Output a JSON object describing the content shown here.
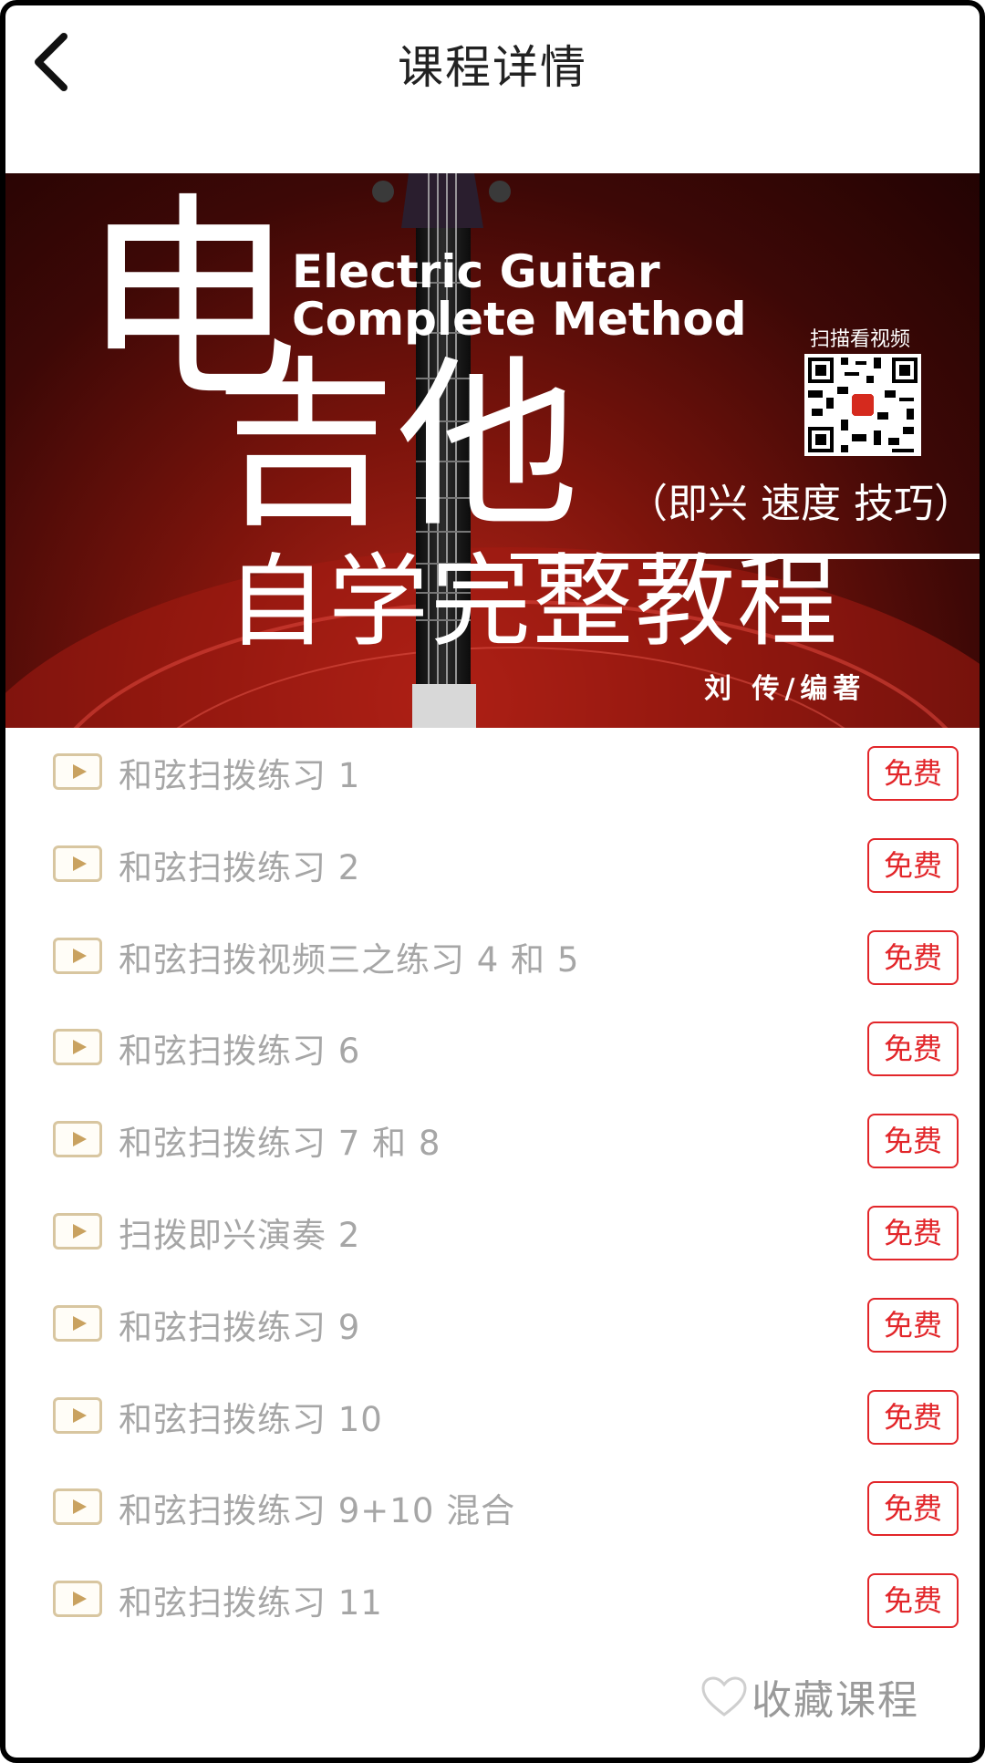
{
  "header": {
    "title": "课程详情",
    "back_icon": "chevron-left-icon"
  },
  "banner": {
    "title_en_line1": "Electric Guitar",
    "title_en_line2": "Complete Method",
    "title_cn_big1": "电",
    "title_cn_big2": "吉他",
    "subtitle": "（即兴 速度 技巧）",
    "main_title": "自学完整教程",
    "author": "刘 传/编著",
    "scan_label": "扫描看视频",
    "watermark": "Electric Guitar"
  },
  "lessons": [
    {
      "title": "和弦扫拨练习 1",
      "badge": "免费"
    },
    {
      "title": "和弦扫拨练习 2",
      "badge": "免费"
    },
    {
      "title": "和弦扫拨视频三之练习 4 和 5",
      "badge": "免费"
    },
    {
      "title": "和弦扫拨练习 6",
      "badge": "免费"
    },
    {
      "title": "和弦扫拨练习 7 和 8",
      "badge": "免费"
    },
    {
      "title": "扫拨即兴演奏 2",
      "badge": "免费"
    },
    {
      "title": "和弦扫拨练习 9",
      "badge": "免费"
    },
    {
      "title": "和弦扫拨练习 10",
      "badge": "免费"
    },
    {
      "title": "和弦扫拨练习 9+10 混合",
      "badge": "免费"
    },
    {
      "title": "和弦扫拨练习 11",
      "badge": "免费"
    }
  ],
  "footer": {
    "favorite_label": "收藏课程",
    "favorite_icon": "heart-outline-icon"
  },
  "colors": {
    "badge_red": "#e2262a",
    "play_icon_gold": "#c9a260",
    "text_gray": "#a6a6a6"
  }
}
